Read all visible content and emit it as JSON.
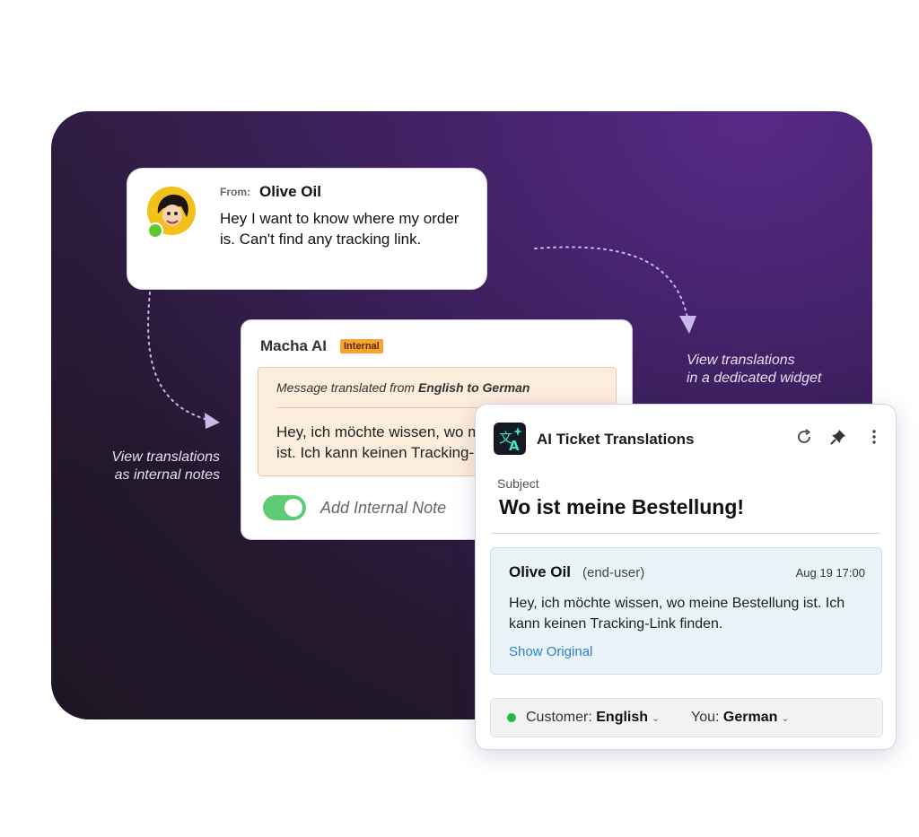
{
  "annotations": {
    "internal_notes": [
      "View translations",
      "as internal notes"
    ],
    "widget": [
      "View translations",
      "in a dedicated widget"
    ]
  },
  "email": {
    "from_label": "From:",
    "from_name": "Olive Oil",
    "body": "Hey I want to know where my order is. Can't find any tracking link."
  },
  "note": {
    "author": "Macha AI",
    "badge": "Internal",
    "translated_prefix": "Message translated from ",
    "translated_langs": "English to German",
    "translated_text": "Hey, ich möchte wissen, wo meine Bestellung ist. Ich kann keinen Tracking-Link finden.",
    "toggle_on": true,
    "toggle_label": "Add Internal Note"
  },
  "widget": {
    "title": "AI Ticket Translations",
    "icons": [
      "refresh-icon",
      "pin-icon",
      "more-vertical-icon"
    ],
    "subject_label": "Subject",
    "subject": "Wo ist meine Bestellung!",
    "message": {
      "author": "Olive Oil",
      "role": "(end-user)",
      "date": "Aug 19 17:00",
      "body": "Hey, ich möchte wissen, wo meine Bestellung ist. Ich kann keinen Tracking-Link finden.",
      "show_original": "Show Original"
    },
    "languages": {
      "customer_label": "Customer:",
      "customer_lang": "English",
      "you_label": "You:",
      "you_lang": "German",
      "status_color": "#22bb44"
    }
  },
  "colors": {
    "panel_gradient": [
      "#5a2a8c",
      "#24182f"
    ],
    "badge_internal": "#f5a431",
    "translate_box": "#fdeddc",
    "toggle": "#5ecb75",
    "message_box": "#eaf4f8",
    "link": "#2b7fd6"
  }
}
